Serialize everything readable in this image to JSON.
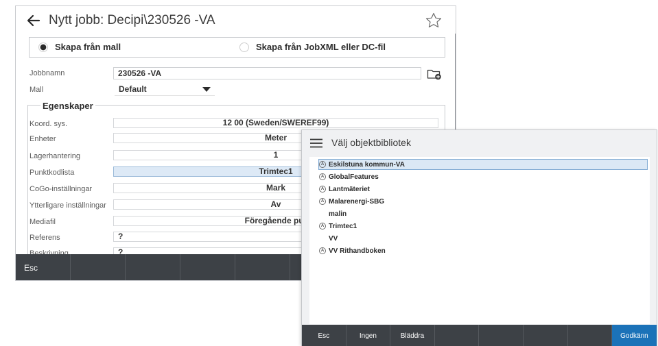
{
  "job": {
    "title": "Nytt jobb:  Decipi\\230526 -VA",
    "source_option_template": "Skapa från mall",
    "source_option_file": "Skapa från JobXML eller DC-fil",
    "jobname_label": "Jobbnamn",
    "jobname_value": "230526 -VA",
    "template_label": "Mall",
    "template_value": "Default",
    "properties_heading": "Egenskaper",
    "properties": [
      {
        "label": "Koord. sys.",
        "value": "12 00 (Sweden/SWEREF99)"
      },
      {
        "label": "Enheter",
        "value": "Meter"
      },
      {
        "label": "Lagerhantering",
        "value": "1"
      },
      {
        "label": "Punktkodlista",
        "value": "Trimtec1"
      },
      {
        "label": "CoGo-inställningar",
        "value": "Mark"
      },
      {
        "label": "Ytterligare inställningar",
        "value": "Av"
      },
      {
        "label": "Mediafil",
        "value": "Föregående pur"
      },
      {
        "label": "Referens",
        "value": "?"
      },
      {
        "label": "Beskrivning",
        "value": "?"
      }
    ],
    "softkeys": [
      "Esc",
      "",
      "",
      "",
      "",
      "",
      "",
      ""
    ]
  },
  "dialog": {
    "title": "Välj objektbibliotek",
    "libraries": [
      {
        "name": "Eskilstuna kommun-VA",
        "icon": "A",
        "selected": true
      },
      {
        "name": "GlobalFeatures",
        "icon": "A"
      },
      {
        "name": "Lantmäteriet",
        "icon": "A"
      },
      {
        "name": "Malarenergi-SBG",
        "icon": "A"
      },
      {
        "name": "malin",
        "icon": ""
      },
      {
        "name": "Trimtec1",
        "icon": "A"
      },
      {
        "name": "VV",
        "icon": ""
      },
      {
        "name": "VV Rithandboken",
        "icon": "A"
      }
    ],
    "softkeys": [
      "Esc",
      "Ingen",
      "Bläddra",
      "",
      "",
      "",
      "",
      "Godkänn"
    ]
  },
  "colors": {
    "softkey_bar": "#3d4146",
    "primary_button": "#1b72b8",
    "selection": "#dde9f6"
  }
}
